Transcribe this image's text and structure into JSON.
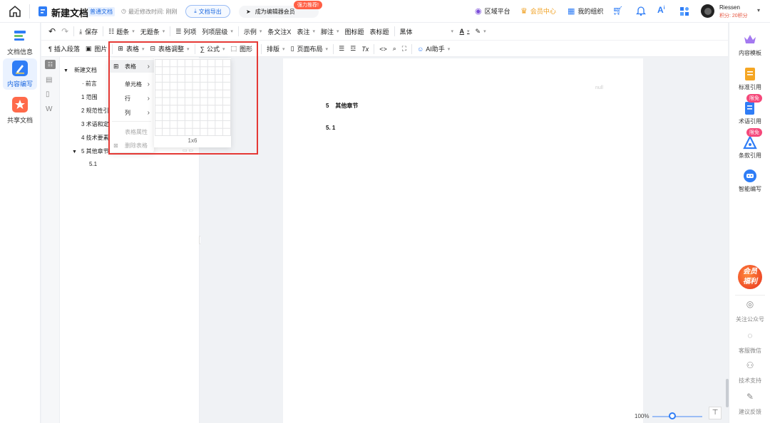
{
  "topbar": {
    "doc_title": "新建文档",
    "doc_type_badge": "普通文档",
    "last_modified": "最近修改时间: 刚刚",
    "export_button": "文档导出",
    "upgrade_button": "成为编辑器会员",
    "upgrade_hot_badge": "强力推荐!",
    "region_platform": "区域平台",
    "member_center": "会员中心",
    "my_org": "我的组织",
    "user_name": "Riessen",
    "user_points": "积分: 20积分"
  },
  "leftnav": {
    "items": [
      {
        "label": "文档信息"
      },
      {
        "label": "内容编写"
      },
      {
        "label": "共享文档"
      }
    ]
  },
  "toolbar": {
    "row1": {
      "save": "保存",
      "heading_item": "题条",
      "no_heading_item": "无题条",
      "list_item": "列项",
      "list_level": "列项层级",
      "example": "示例",
      "clause_note": "条文注X",
      "table_note": "表注",
      "footnote": "脚注",
      "figure_title": "图标题",
      "table_title": "表标题",
      "font_name": "黑体"
    },
    "row2": {
      "insert_paragraph": "插入段落",
      "image": "图片",
      "table": "表格",
      "table_adjust": "表格调整",
      "formula": "公式",
      "shape": "图形",
      "typeset": "排版",
      "page_layout": "页面布局",
      "ai_assistant": "AI助手"
    }
  },
  "outline": {
    "items": [
      {
        "label": "新建文档"
      },
      {
        "label": "前言"
      },
      {
        "label": "1  范围"
      },
      {
        "label": "2  规范性引"
      },
      {
        "label": "3  术语和定"
      },
      {
        "label": "4  技术要素"
      },
      {
        "label": "5  其他章节"
      },
      {
        "label": "5.1"
      }
    ]
  },
  "table_menu": {
    "items": [
      {
        "label": "表格"
      },
      {
        "label": "单元格"
      },
      {
        "label": "行"
      },
      {
        "label": "列"
      },
      {
        "label": "表格属性"
      },
      {
        "label": "删除表格"
      }
    ],
    "grid_size_label": "1x6"
  },
  "page": {
    "header_text": "null",
    "heading": "5    其他章节",
    "subheading": "5. 1"
  },
  "rightbar": {
    "items": [
      {
        "label": "内容模板"
      },
      {
        "label": "标准引用"
      },
      {
        "label": "术语引用",
        "badge": "限免"
      },
      {
        "label": "条款引用",
        "badge": "限免"
      },
      {
        "label": "智能编写"
      }
    ],
    "promo_line1": "会员",
    "promo_line2": "福利",
    "bottom_items": [
      {
        "label": "关注公众号"
      },
      {
        "label": "客服微信"
      },
      {
        "label": "技术支持"
      },
      {
        "label": "建议反馈"
      }
    ]
  },
  "zoom": {
    "value": "100%",
    "level": 0.4
  },
  "colors": {
    "accent": "#1f6ae0",
    "highlight_box": "#e53935",
    "badge_pink": "#f5487a",
    "gold": "#f0a020"
  }
}
